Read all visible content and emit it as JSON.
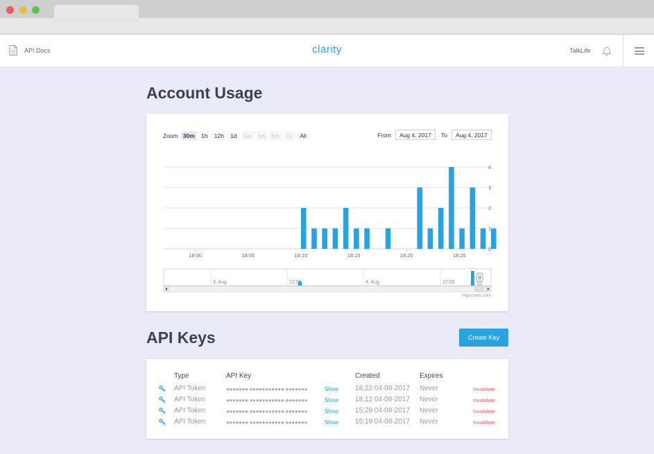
{
  "header": {
    "docs_link": "API Docs",
    "logo": "clarity",
    "account_name": "TalkLife"
  },
  "usage": {
    "title": "Account Usage",
    "zoom_label": "Zoom",
    "zoom_buttons": [
      {
        "label": "30m",
        "state": "active"
      },
      {
        "label": "1h",
        "state": "enabled"
      },
      {
        "label": "12h",
        "state": "enabled"
      },
      {
        "label": "1d",
        "state": "enabled"
      },
      {
        "label": "1w",
        "state": "disabled"
      },
      {
        "label": "1m",
        "state": "disabled"
      },
      {
        "label": "6m",
        "state": "disabled"
      },
      {
        "label": "1y",
        "state": "disabled"
      },
      {
        "label": "All",
        "state": "enabled"
      }
    ],
    "from_label": "From",
    "from_value": "Aug 4, 2017",
    "to_label": "To",
    "to_value": "Aug 4, 2017",
    "credits": "Highcharts.com"
  },
  "chart_data": {
    "type": "bar",
    "x": [
      "18:10",
      "18:11",
      "18:12",
      "18:13",
      "18:14",
      "18:15",
      "18:16",
      "18:18",
      "18:21",
      "18:22",
      "18:23",
      "18:24",
      "18:25",
      "18:26",
      "18:27",
      "18:28"
    ],
    "values": [
      2,
      1,
      1,
      1,
      2,
      1,
      1,
      1,
      3,
      1,
      2,
      4,
      1,
      3,
      1,
      1
    ],
    "xticks": [
      "18:00",
      "18:05",
      "18:10",
      "18:15",
      "18:20",
      "18:25"
    ],
    "yticks": [
      "0",
      "1",
      "2",
      "3",
      "4"
    ],
    "ylim": [
      0,
      4
    ],
    "xlim": [
      "17:57",
      "18:28"
    ],
    "navigator_labels": [
      "3. Aug",
      "12:00",
      "4. Aug",
      "12:00"
    ],
    "bar_color": "#2ba1e0",
    "grid": true,
    "y_axis_side": "right"
  },
  "keys": {
    "title": "API Keys",
    "create_button": "Create Key",
    "columns": {
      "type": "Type",
      "key": "API Key",
      "created": "Created",
      "expires": "Expires"
    },
    "rows": [
      {
        "type": "API Token",
        "key": "●●●●●●●.●●●●●●●●●●●.●●●●●●●",
        "show": "Show",
        "created": "18:22 04-08-2017",
        "expires": "Never",
        "action": "Invalidate"
      },
      {
        "type": "API Token",
        "key": "●●●●●●●.●●●●●●●●●●●.●●●●●●●",
        "show": "Show",
        "created": "18:12 04-08-2017",
        "expires": "Never",
        "action": "Invalidate"
      },
      {
        "type": "API Token",
        "key": "●●●●●●●.●●●●●●●●●●●.●●●●●●●",
        "show": "Show",
        "created": "15:29 04-08-2017",
        "expires": "Never",
        "action": "Invalidate"
      },
      {
        "type": "API Token",
        "key": "●●●●●●●.●●●●●●●●●●●.●●●●●●●",
        "show": "Show",
        "created": "15:19 04-08-2017",
        "expires": "Never",
        "action": "Invalidate"
      }
    ]
  },
  "colors": {
    "accent": "#2ba1e0",
    "danger": "#e05b5b",
    "background": "#e9ecf8"
  }
}
